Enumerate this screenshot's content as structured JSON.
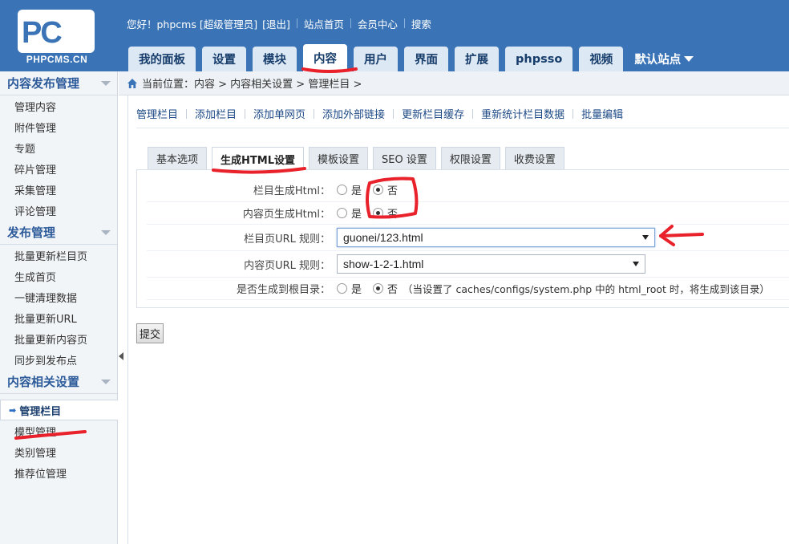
{
  "logo": {
    "letters": "PC",
    "text": "PHPCMS.CN"
  },
  "topbar": {
    "greeting": "您好！phpcms [超级管理员]",
    "logout": "[退出]",
    "site_home": "站点首页",
    "member_center": "会员中心",
    "search": "搜索"
  },
  "nav": {
    "tabs": [
      {
        "label": "我的面板"
      },
      {
        "label": "设置"
      },
      {
        "label": "模块"
      },
      {
        "label": "内容"
      },
      {
        "label": "用户"
      },
      {
        "label": "界面"
      },
      {
        "label": "扩展"
      },
      {
        "label": "phpsso"
      },
      {
        "label": "视频"
      }
    ],
    "active_index": 3,
    "site_select": "默认站点"
  },
  "sidebar": {
    "groups": [
      {
        "title": "内容发布管理",
        "items": [
          "管理内容",
          "附件管理",
          "专题",
          "碎片管理",
          "采集管理",
          "评论管理"
        ]
      },
      {
        "title": "发布管理",
        "items": [
          "批量更新栏目页",
          "生成首页",
          "一键清理数据",
          "批量更新URL",
          "批量更新内容页",
          "同步到发布点"
        ]
      },
      {
        "title": "内容相关设置",
        "items": [
          "管理栏目",
          "模型管理",
          "类别管理",
          "推荐位管理"
        ]
      }
    ],
    "active_item": "管理栏目"
  },
  "breadcrumb": {
    "text": "当前位置：内容 > 内容相关设置 > 管理栏目 >"
  },
  "subnav": {
    "links": [
      "管理栏目",
      "添加栏目",
      "添加单网页",
      "添加外部链接",
      "更新栏目缓存",
      "重新统计栏目数据",
      "批量编辑"
    ]
  },
  "form_tabs": {
    "tabs": [
      "基本选项",
      "生成HTML设置",
      "模板设置",
      "SEO 设置",
      "权限设置",
      "收费设置"
    ],
    "active_index": 1
  },
  "form": {
    "rows": [
      {
        "label": "栏目生成Html：",
        "yes": "是",
        "no": "否",
        "selected": "否"
      },
      {
        "label": "内容页生成Html：",
        "yes": "是",
        "no": "否",
        "selected": "否"
      },
      {
        "label": "栏目页URL 规则：",
        "value": "guonei/123.html"
      },
      {
        "label": "内容页URL 规则：",
        "value": "show-1-2-1.html"
      },
      {
        "label": "是否生成到根目录：",
        "yes": "是",
        "no": "否",
        "selected": "否",
        "note": "（当设置了 caches/configs/system.php 中的 html_root 时，将生成到该目录）"
      }
    ]
  },
  "submit_label": "提交",
  "colors": {
    "header_bg": "#3a74b6",
    "nav_tab_bg": "#dde8f5",
    "sidebar_bg": "#f2f5f8",
    "link": "#1d4a86",
    "annotation_red": "#e8212a"
  }
}
